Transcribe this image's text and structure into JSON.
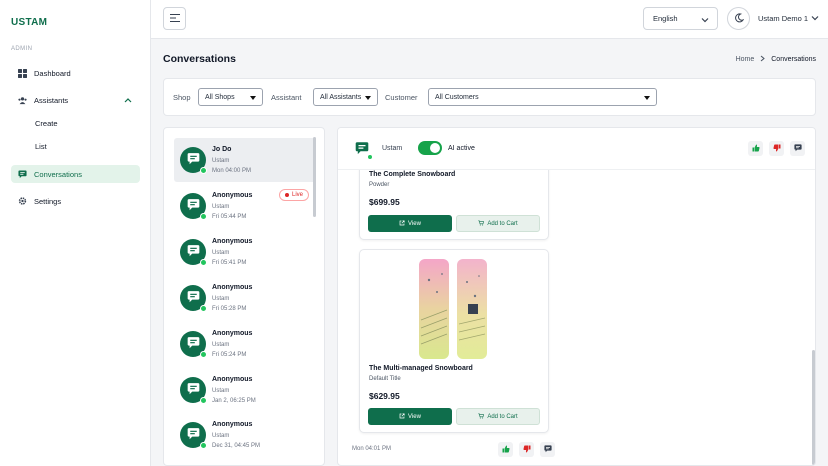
{
  "app": {
    "brand": "USTAM"
  },
  "sidebar": {
    "section_label": "ADMIN",
    "items": [
      {
        "label": "Dashboard"
      },
      {
        "label": "Assistants"
      },
      {
        "label": "Create"
      },
      {
        "label": "List"
      },
      {
        "label": "Conversations"
      },
      {
        "label": "Settings"
      }
    ]
  },
  "topbar": {
    "language": "English",
    "user": "Ustam Demo 1"
  },
  "page": {
    "title": "Conversations",
    "breadcrumb": [
      "Home",
      "Conversations"
    ]
  },
  "filters": {
    "shop_label": "Shop",
    "shop_value": "All Shops",
    "assistant_label": "Assistant",
    "assistant_value": "All Assistants",
    "customer_label": "Customer",
    "customer_value": "All Customers"
  },
  "conversations": [
    {
      "name": "Jo Do",
      "shop": "Ustam",
      "time": "Mon 04:00 PM"
    },
    {
      "name": "Anonymous",
      "shop": "Ustam",
      "time": "Fri 05:44 PM",
      "badge": "Live"
    },
    {
      "name": "Anonymous",
      "shop": "Ustam",
      "time": "Fri 05:41 PM"
    },
    {
      "name": "Anonymous",
      "shop": "Ustam",
      "time": "Fri 05:28 PM"
    },
    {
      "name": "Anonymous",
      "shop": "Ustam",
      "time": "Fri 05:24 PM"
    },
    {
      "name": "Anonymous",
      "shop": "Ustam",
      "time": "Jan 2, 06:25 PM"
    },
    {
      "name": "Anonymous",
      "shop": "Ustam",
      "time": "Dec 31, 04:45 PM"
    }
  ],
  "chat": {
    "header_name": "Ustam",
    "ai_label": "AI active",
    "products": [
      {
        "name": "The Complete Snowboard",
        "variant": "Powder",
        "price": "$699.95",
        "view": "View",
        "cart": "Add to Cart"
      },
      {
        "name": "The Multi-managed Snowboard",
        "variant": "Default Title",
        "price": "$629.95",
        "view": "View",
        "cart": "Add to Cart"
      }
    ],
    "message_time": "Mon 04:01 PM"
  },
  "colors": {
    "brand": "#0f6e4c",
    "accent_light": "#e3f3ea",
    "online": "#22c55e",
    "live": "#dc2626"
  }
}
